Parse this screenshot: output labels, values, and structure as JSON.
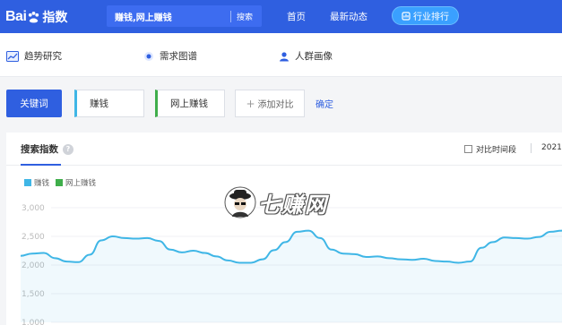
{
  "header": {
    "logo": {
      "latin": "Bai",
      "chinese": "指数"
    },
    "search": {
      "value": "赚钱,网上赚钱",
      "button_label": "搜索"
    },
    "nav": {
      "home": "首页",
      "news": "最新动态",
      "rank": "行业排行"
    }
  },
  "tabs": {
    "trend": "趋势研究",
    "demand": "需求图谱",
    "crowd": "人群画像"
  },
  "keywords": {
    "main_label": "关键词",
    "items": [
      "赚钱",
      "网上赚钱"
    ],
    "add_label": "添加对比",
    "confirm_label": "确定"
  },
  "card": {
    "tab_title": "搜索指数",
    "help": "?",
    "compare_period": "对比时间段",
    "year": "2021"
  },
  "colors": {
    "brand": "#2f5fe0",
    "series_1": "#3fb6e6",
    "series_2": "#3fae4b"
  },
  "chart_data": {
    "type": "line",
    "y_ticks": [
      "3,000",
      "2,500",
      "2,000",
      "1,500",
      "1,000"
    ],
    "ylim": [
      1000,
      3000
    ],
    "legend": [
      "赚钱",
      "网上赚钱"
    ],
    "series": [
      {
        "name": "赚钱",
        "values": [
          2160,
          2200,
          2210,
          2120,
          2060,
          2050,
          2180,
          2430,
          2500,
          2470,
          2460,
          2470,
          2420,
          2270,
          2220,
          2250,
          2210,
          2150,
          2080,
          2040,
          2040,
          2100,
          2260,
          2400,
          2580,
          2600,
          2470,
          2270,
          2200,
          2190,
          2140,
          2150,
          2120,
          2100,
          2090,
          2110,
          2070,
          2060,
          2040,
          2060,
          2300,
          2400,
          2480,
          2470,
          2460,
          2490,
          2580,
          2600
        ]
      }
    ]
  },
  "watermark": {
    "text": "七赚网"
  }
}
